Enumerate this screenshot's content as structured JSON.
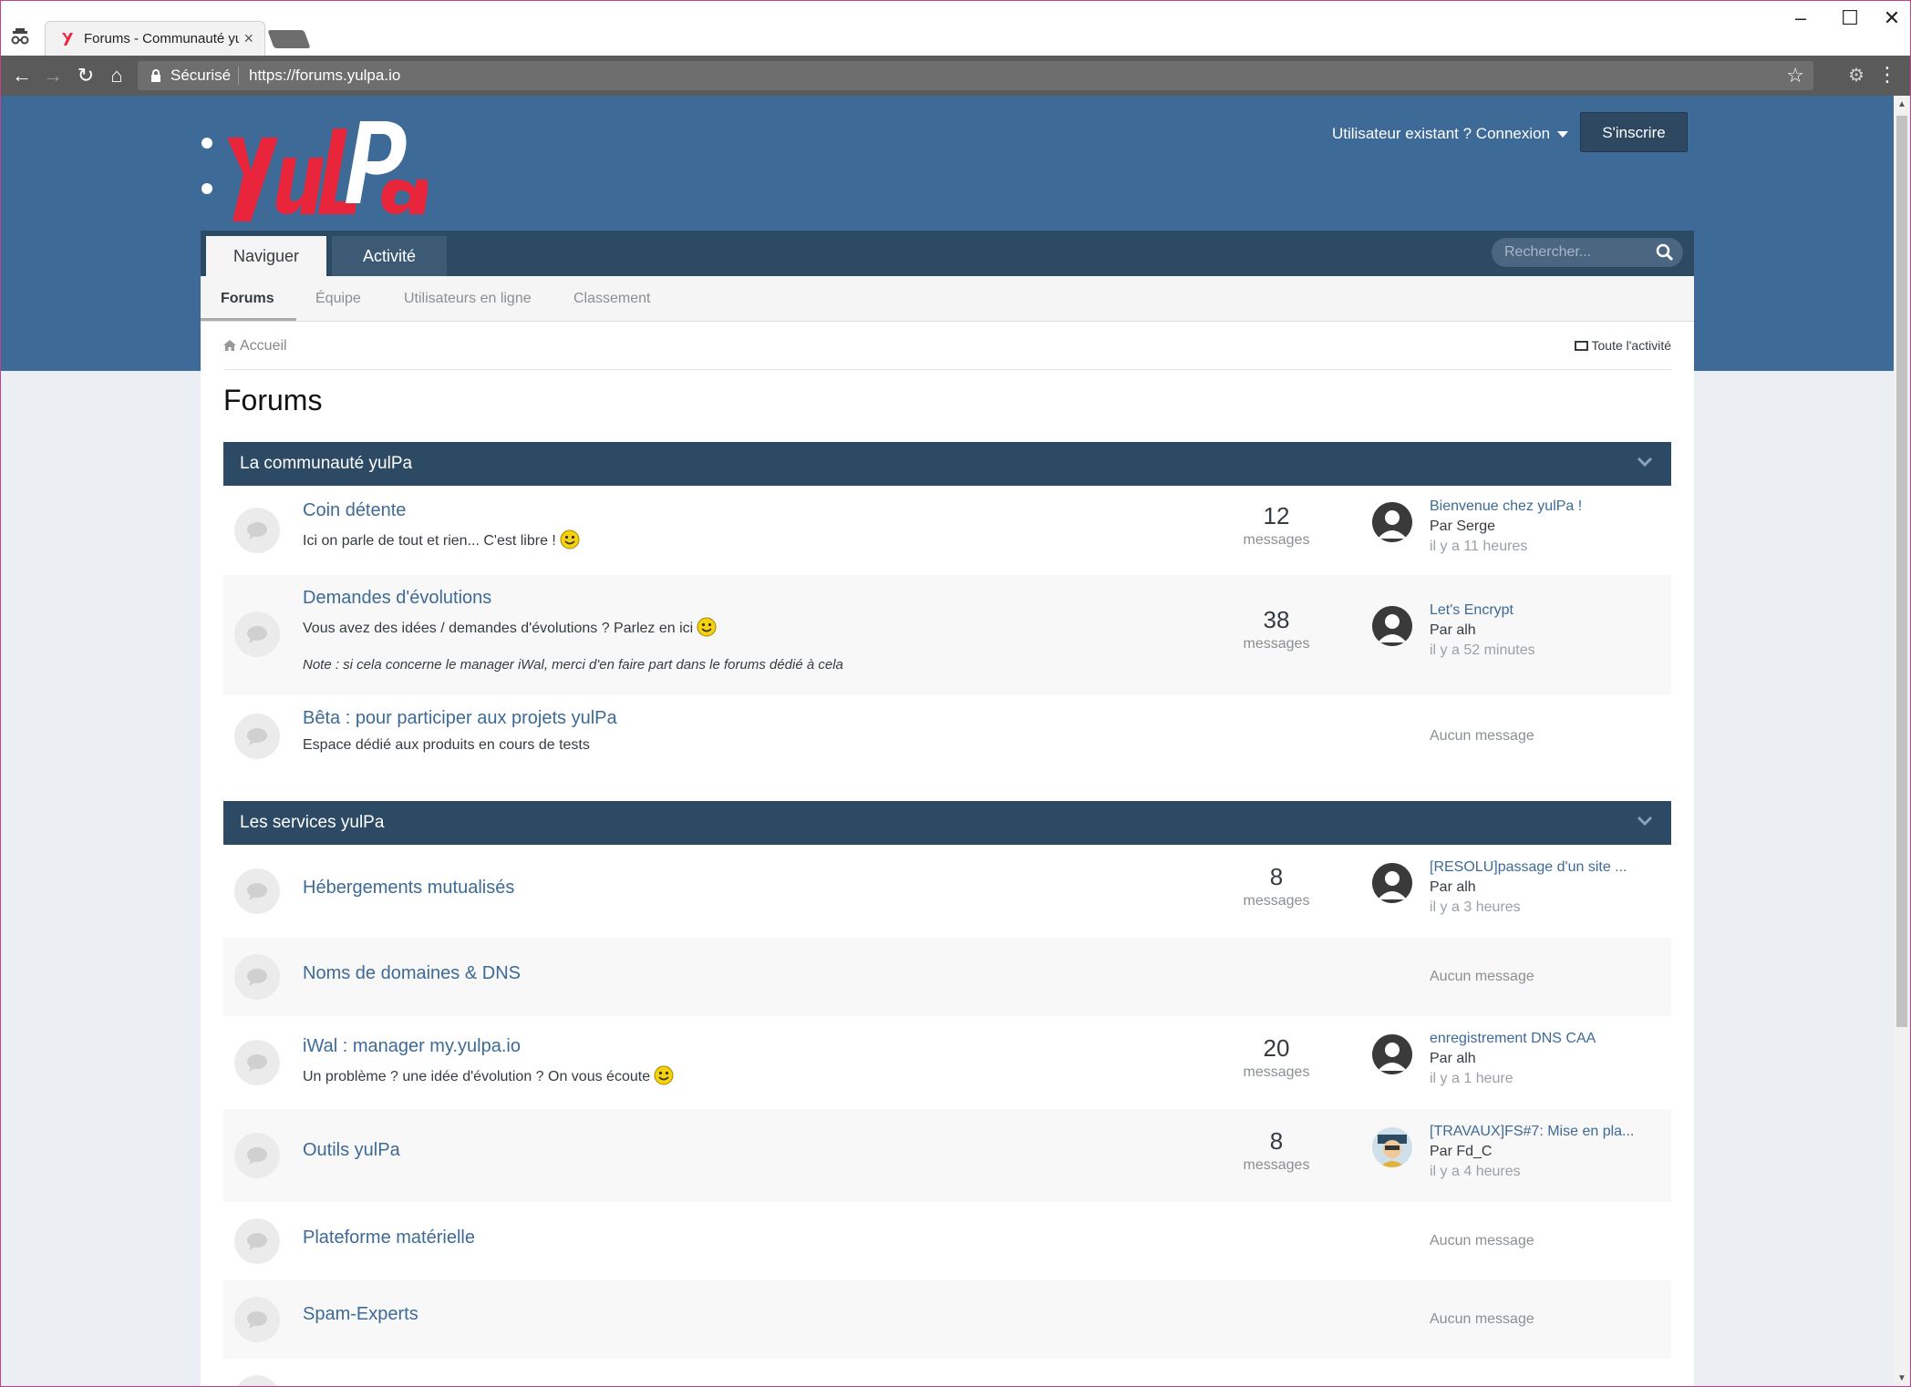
{
  "browser": {
    "tab_title": "Forums - Communauté yulPa",
    "secure_label": "Sécurisé",
    "url": "https://forums.yulpa.io"
  },
  "header": {
    "signin_label": "Utilisateur existant ? Connexion",
    "register_label": "S'inscrire",
    "brand_color": "#3d6a96",
    "logo_color": "#e8253b"
  },
  "nav": {
    "tabs": [
      {
        "label": "Naviguer"
      },
      {
        "label": "Activité"
      }
    ],
    "search_placeholder": "Rechercher...",
    "subtabs": [
      {
        "label": "Forums"
      },
      {
        "label": "Équipe"
      },
      {
        "label": "Utilisateurs en ligne"
      },
      {
        "label": "Classement"
      }
    ]
  },
  "breadcrumb": {
    "home": "Accueil",
    "all_activity": "Toute l'activité"
  },
  "page_title": "Forums",
  "categories": [
    {
      "title": "La communauté yulPa",
      "forums": [
        {
          "title": "Coin détente",
          "desc": "Ici on parle de tout et rien... C'est libre !",
          "count": "12",
          "count_label": "messages",
          "last_title": "Bienvenue chez yulPa !",
          "last_by": "Par Serge",
          "last_date": "il y a 11 heures"
        },
        {
          "title": "Demandes d'évolutions",
          "desc": "Vous avez des idées / demandes d'évolutions ? Parlez en ici",
          "note": "Note : si cela concerne le manager iWal, merci d'en faire part dans le forums dédié à cela",
          "count": "38",
          "count_label": "messages",
          "last_title": "Let's Encrypt",
          "last_by": "Par alh",
          "last_date": "il y a 52 minutes"
        },
        {
          "title": "Bêta : pour participer aux projets yulPa",
          "desc": "Espace dédié aux produits en cours de tests",
          "none_label": "Aucun message"
        }
      ]
    },
    {
      "title": "Les services yulPa",
      "forums": [
        {
          "title": "Hébergements mutualisés",
          "count": "8",
          "count_label": "messages",
          "last_title": "[RESOLU]passage d'un site ...",
          "last_by": "Par alh",
          "last_date": "il y a 3 heures"
        },
        {
          "title": "Noms de domaines & DNS",
          "none_label": "Aucun message"
        },
        {
          "title": "iWal : manager my.yulpa.io",
          "desc": "Un problème ? une idée d'évolution ? On vous écoute",
          "count": "20",
          "count_label": "messages",
          "last_title": "enregistrement DNS CAA",
          "last_by": "Par alh",
          "last_date": "il y a 1 heure"
        },
        {
          "title": "Outils yulPa",
          "count": "8",
          "count_label": "messages",
          "last_title": "[TRAVAUX]FS#7: Mise en pla...",
          "last_by": "Par Fd_C",
          "last_date": "il y a 4 heures"
        },
        {
          "title": "Plateforme matérielle",
          "none_label": "Aucun message"
        },
        {
          "title": "Spam-Experts",
          "none_label": "Aucun message"
        }
      ]
    }
  ]
}
